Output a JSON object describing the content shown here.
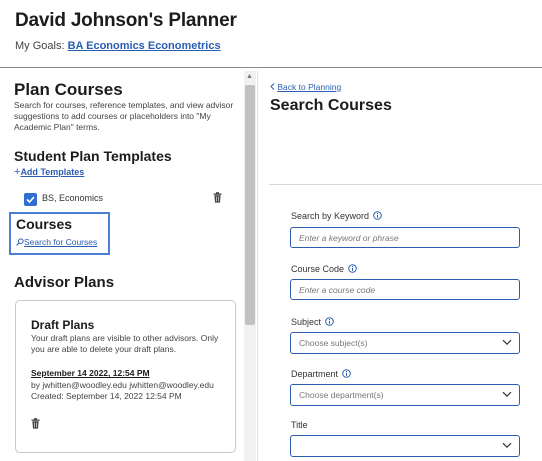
{
  "header": {
    "title": "David Johnson's Planner",
    "goals_label": "My Goals:",
    "goals_link": "BA Economics Econometrics"
  },
  "left": {
    "plan_courses_title": "Plan Courses",
    "plan_courses_desc": "Search for courses, reference templates, and view advisor suggestions to add courses or placeholders into \"My Academic Plan\" terms.",
    "templates_title": "Student Plan Templates",
    "add_templates_icon": "+",
    "add_templates_label": "Add Templates",
    "template_item": "BS, Economics",
    "courses_title": "Courses",
    "search_courses_label": "Search for Courses",
    "advisor_title": "Advisor Plans",
    "draft": {
      "title": "Draft Plans",
      "desc": "Your draft plans are visible to other advisors. Only you are able to delete your draft plans.",
      "date": "September 14 2022, 12:54 PM",
      "by": "by jwhitten@woodley.edu jwhitten@woodley.edu",
      "created": "Created: September 14, 2022 12:54 PM"
    }
  },
  "right": {
    "back_label": "Back to Planning",
    "title": "Search Courses",
    "keyword_label": "Search by Keyword",
    "keyword_placeholder": "Enter a keyword or phrase",
    "course_code_label": "Course Code",
    "course_code_placeholder": "Enter a course code",
    "subject_label": "Subject",
    "subject_value": "Choose subject(s)",
    "department_label": "Department",
    "department_value": "Choose department(s)",
    "title_label": "Title",
    "title_value": ""
  },
  "colors": {
    "accent": "#2a5db0",
    "checkbox": "#2f6fd1",
    "highlight_border": "#4a7fd4"
  },
  "icons": {
    "checkbox": "check-icon",
    "delete": "trash-icon",
    "info": "info-icon",
    "dropdown": "chevron-down-icon",
    "search": "search-icon",
    "back": "chevron-left-icon"
  }
}
